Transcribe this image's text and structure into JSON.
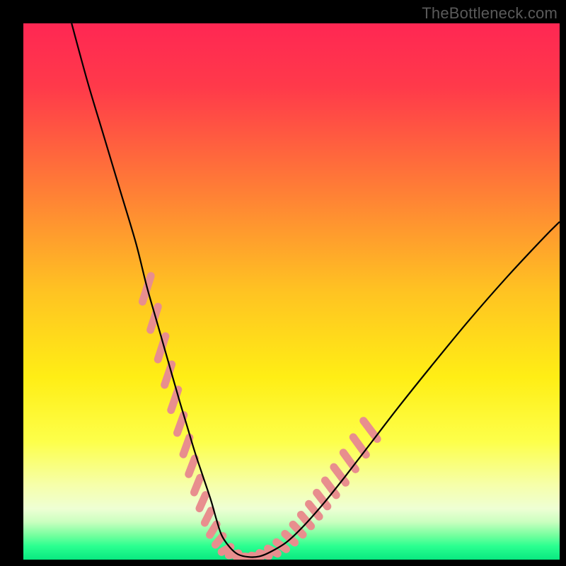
{
  "watermark": "TheBottleneck.com",
  "chart_data": {
    "type": "line",
    "title": "",
    "xlabel": "",
    "ylabel": "",
    "xlim": [
      0,
      100
    ],
    "ylim": [
      0,
      100
    ],
    "grid": false,
    "legend": false,
    "gradient_stops": [
      {
        "offset": 0,
        "color": "#ff2753"
      },
      {
        "offset": 0.12,
        "color": "#ff3a4a"
      },
      {
        "offset": 0.3,
        "color": "#ff7a37"
      },
      {
        "offset": 0.5,
        "color": "#ffc322"
      },
      {
        "offset": 0.66,
        "color": "#ffee15"
      },
      {
        "offset": 0.78,
        "color": "#fdff4a"
      },
      {
        "offset": 0.86,
        "color": "#f6ffa9"
      },
      {
        "offset": 0.905,
        "color": "#eeffd4"
      },
      {
        "offset": 0.93,
        "color": "#c9ffbf"
      },
      {
        "offset": 0.955,
        "color": "#74ff9e"
      },
      {
        "offset": 0.975,
        "color": "#2aff90"
      },
      {
        "offset": 1.0,
        "color": "#09e880"
      }
    ],
    "series": [
      {
        "name": "bottleneck-curve",
        "color": "#000000",
        "width": 2.2,
        "x": [
          9.0,
          12,
          15,
          18,
          21,
          23,
          25,
          27,
          29,
          30.5,
          32,
          33.5,
          35,
          36,
          37,
          38.5,
          40,
          42,
          44,
          46,
          49,
          52,
          56,
          60,
          65,
          70,
          76,
          83,
          90,
          97,
          100
        ],
        "y": [
          100,
          89,
          79,
          69,
          59,
          51,
          44,
          37,
          30,
          25,
          20,
          15.5,
          11,
          7.5,
          4.5,
          2.3,
          1.0,
          0.5,
          0.6,
          1.4,
          3.2,
          6.0,
          10.5,
          15.5,
          22,
          28.5,
          36,
          44.5,
          52.5,
          60,
          63
        ]
      }
    ],
    "highlight_bands": [
      {
        "name": "left-descent-dashes",
        "color": "#e88e8e",
        "points": [
          {
            "x": 23.0,
            "y": 50.5,
            "len": 6.5,
            "ang": -72
          },
          {
            "x": 24.4,
            "y": 45.0,
            "len": 6.0,
            "ang": -72
          },
          {
            "x": 25.8,
            "y": 39.5,
            "len": 6.0,
            "ang": -72
          },
          {
            "x": 27.0,
            "y": 34.5,
            "len": 5.5,
            "ang": -71
          },
          {
            "x": 28.2,
            "y": 29.8,
            "len": 5.5,
            "ang": -71
          },
          {
            "x": 29.3,
            "y": 25.3,
            "len": 5.0,
            "ang": -70
          },
          {
            "x": 30.4,
            "y": 21.2,
            "len": 4.8,
            "ang": -70
          },
          {
            "x": 31.4,
            "y": 17.4,
            "len": 4.6,
            "ang": -69
          },
          {
            "x": 32.4,
            "y": 13.9,
            "len": 4.4,
            "ang": -68
          },
          {
            "x": 33.4,
            "y": 10.8,
            "len": 4.2,
            "ang": -66
          },
          {
            "x": 34.4,
            "y": 8.0,
            "len": 4.0,
            "ang": -63
          },
          {
            "x": 35.4,
            "y": 5.6,
            "len": 3.8,
            "ang": -58
          },
          {
            "x": 36.5,
            "y": 3.6,
            "len": 3.6,
            "ang": -50
          }
        ]
      },
      {
        "name": "valley-dashes",
        "color": "#e88e8e",
        "points": [
          {
            "x": 37.8,
            "y": 1.9,
            "len": 3.4,
            "ang": -30
          },
          {
            "x": 39.2,
            "y": 1.0,
            "len": 3.3,
            "ang": -12
          },
          {
            "x": 40.6,
            "y": 0.55,
            "len": 3.2,
            "ang": -2
          },
          {
            "x": 42.0,
            "y": 0.5,
            "len": 3.2,
            "ang": 4
          },
          {
            "x": 43.4,
            "y": 0.6,
            "len": 3.2,
            "ang": 10
          },
          {
            "x": 44.9,
            "y": 0.95,
            "len": 3.3,
            "ang": 18
          }
        ]
      },
      {
        "name": "right-ascent-dashes",
        "color": "#e88e8e",
        "points": [
          {
            "x": 46.5,
            "y": 1.6,
            "len": 3.5,
            "ang": 28
          },
          {
            "x": 48.1,
            "y": 2.6,
            "len": 3.7,
            "ang": 36
          },
          {
            "x": 49.7,
            "y": 4.0,
            "len": 3.9,
            "ang": 42
          },
          {
            "x": 51.2,
            "y": 5.6,
            "len": 4.1,
            "ang": 46
          },
          {
            "x": 52.7,
            "y": 7.3,
            "len": 4.3,
            "ang": 49
          },
          {
            "x": 54.2,
            "y": 9.2,
            "len": 4.5,
            "ang": 51
          },
          {
            "x": 55.7,
            "y": 11.2,
            "len": 4.7,
            "ang": 52
          },
          {
            "x": 57.3,
            "y": 13.4,
            "len": 4.9,
            "ang": 53
          },
          {
            "x": 59.0,
            "y": 15.8,
            "len": 5.1,
            "ang": 53
          },
          {
            "x": 60.8,
            "y": 18.4,
            "len": 5.3,
            "ang": 54
          },
          {
            "x": 62.7,
            "y": 21.2,
            "len": 5.5,
            "ang": 54
          },
          {
            "x": 64.7,
            "y": 24.2,
            "len": 5.7,
            "ang": 53
          }
        ]
      }
    ]
  }
}
